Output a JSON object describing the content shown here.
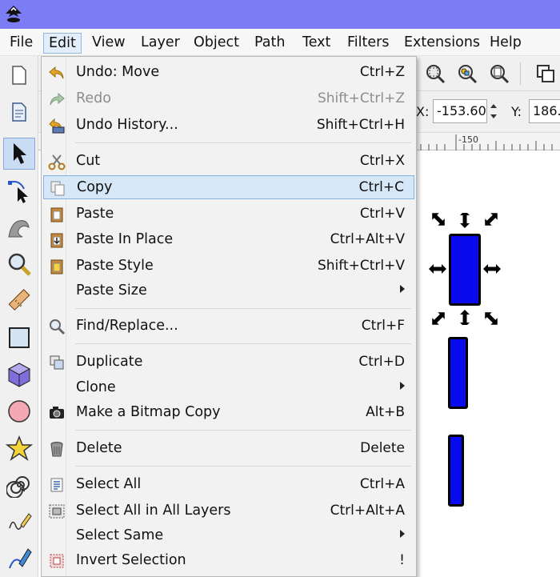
{
  "menubar": [
    "File",
    "Edit",
    "View",
    "Layer",
    "Object",
    "Path",
    "Text",
    "Filters",
    "Extensions",
    "Help"
  ],
  "edit_menu": [
    {
      "label": "Undo: Move",
      "shortcut": "Ctrl+Z",
      "icon": "undo-icon"
    },
    {
      "label": "Redo",
      "shortcut": "Shift+Ctrl+Z",
      "icon": "redo-icon",
      "disabled": true
    },
    {
      "label": "Undo History...",
      "shortcut": "Shift+Ctrl+H",
      "icon": "undo-history-icon"
    },
    {
      "label": "Cut",
      "shortcut": "Ctrl+X",
      "icon": "cut-icon"
    },
    {
      "label": "Copy",
      "shortcut": "Ctrl+C",
      "icon": "copy-icon",
      "highlighted": true
    },
    {
      "label": "Paste",
      "shortcut": "Ctrl+V",
      "icon": "paste-icon"
    },
    {
      "label": "Paste In Place",
      "shortcut": "Ctrl+Alt+V",
      "icon": "paste-in-place-icon"
    },
    {
      "label": "Paste Style",
      "shortcut": "Shift+Ctrl+V",
      "icon": "paste-style-icon"
    },
    {
      "label": "Paste Size",
      "shortcut": "",
      "submenu": true
    },
    {
      "label": "Find/Replace...",
      "shortcut": "Ctrl+F",
      "icon": "find-icon"
    },
    {
      "label": "Duplicate",
      "shortcut": "Ctrl+D",
      "icon": "duplicate-icon"
    },
    {
      "label": "Clone",
      "shortcut": "",
      "submenu": true
    },
    {
      "label": "Make a Bitmap Copy",
      "shortcut": "Alt+B",
      "icon": "camera-icon"
    },
    {
      "label": "Delete",
      "shortcut": "Delete",
      "icon": "delete-icon"
    },
    {
      "label": "Select All",
      "shortcut": "Ctrl+A",
      "icon": "select-all-icon"
    },
    {
      "label": "Select All in All Layers",
      "shortcut": "Ctrl+Alt+A",
      "icon": "select-all-layers-icon"
    },
    {
      "label": "Select Same",
      "shortcut": "",
      "submenu": true
    },
    {
      "label": "Invert Selection",
      "shortcut": "!",
      "icon": "invert-selection-icon"
    }
  ],
  "controls": {
    "x_label": "X:",
    "x_value": "-153.60",
    "y_label": "Y:",
    "y_value": "186."
  },
  "ruler": {
    "tick_label": "-150"
  },
  "colors": {
    "shape_fill": "#0a0aee",
    "highlight": "#d6e7f8",
    "titlebar": "#7c7df5"
  }
}
